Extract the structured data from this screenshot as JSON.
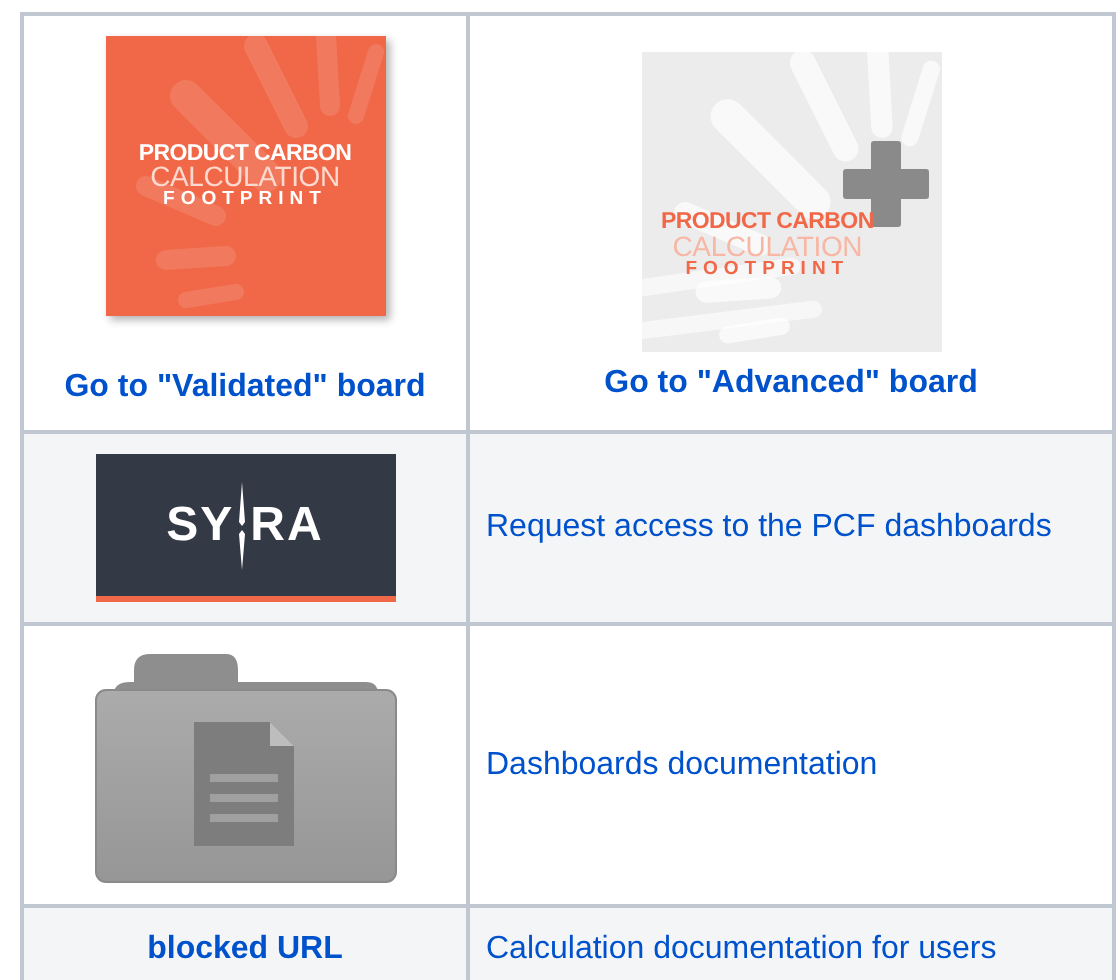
{
  "table": {
    "rows": [
      {
        "cells": [
          {
            "logo": {
              "kind": "pcf-orange",
              "lines": [
                "PRODUCT CARBON",
                "CALCULATION",
                "FOOTPRINT"
              ]
            },
            "link": {
              "text": "Go to \"Validated\" board"
            }
          },
          {
            "logo": {
              "kind": "pcf-grey",
              "lines": [
                "PRODUCT CARBON",
                "CALCULATION",
                "FOOTPRINT"
              ]
            },
            "link": {
              "text": "Go to \"Advanced\" board"
            }
          }
        ]
      },
      {
        "cells": [
          {
            "logo": {
              "kind": "syra",
              "lines": [
                "SY",
                "RA"
              ]
            }
          },
          {
            "link": {
              "text": "Request access to the PCF dashboards"
            }
          }
        ]
      },
      {
        "cells": [
          {
            "logo": {
              "kind": "folder"
            }
          },
          {
            "link": {
              "text": "Dashboards documentation"
            }
          }
        ]
      },
      {
        "cells": [
          {
            "link": {
              "text": "blocked URL"
            }
          },
          {
            "link": {
              "text": "Calculation documentation for users"
            }
          }
        ]
      }
    ]
  }
}
